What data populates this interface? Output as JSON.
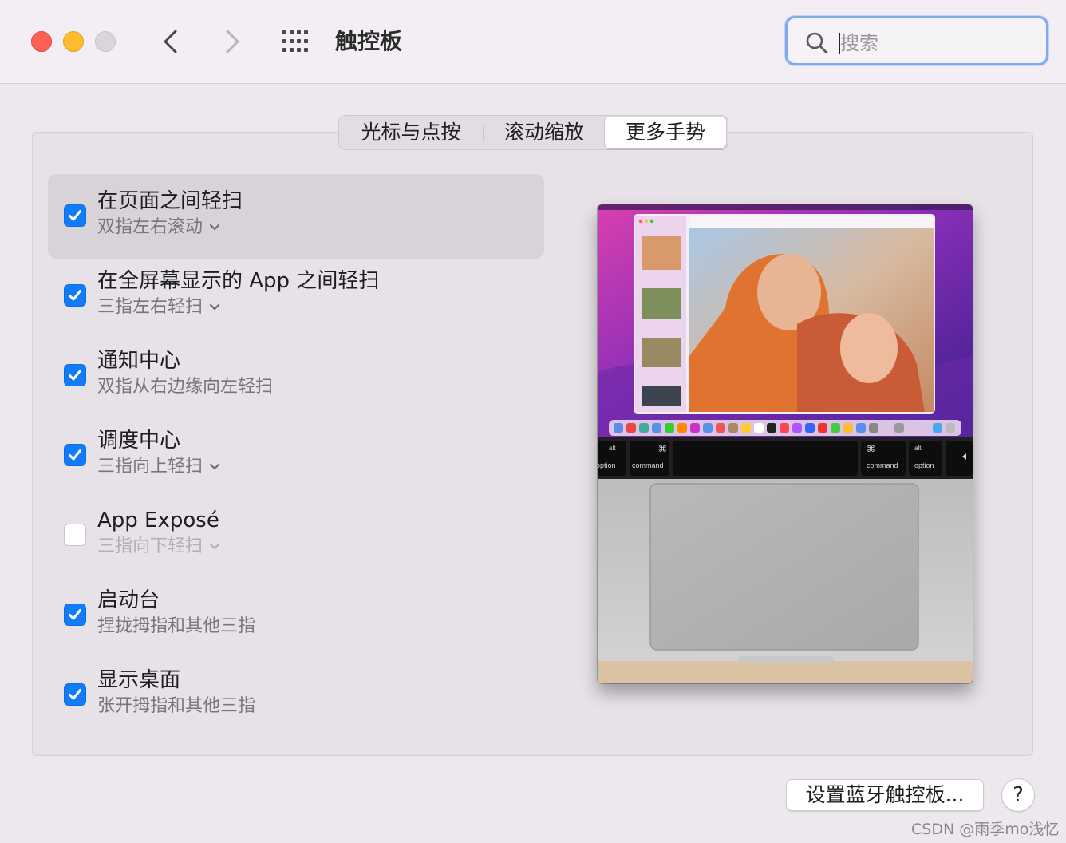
{
  "window": {
    "title": "触控板",
    "search_placeholder": "搜索"
  },
  "tabs": [
    {
      "label": "光标与点按",
      "selected": false
    },
    {
      "label": "滚动缩放",
      "selected": false
    },
    {
      "label": "更多手势",
      "selected": true
    }
  ],
  "gestures": [
    {
      "title": "在页面之间轻扫",
      "subtitle": "双指左右滚动",
      "checked": true,
      "has_dropdown": true,
      "selected": true
    },
    {
      "title": "在全屏幕显示的 App 之间轻扫",
      "subtitle": "三指左右轻扫",
      "checked": true,
      "has_dropdown": true,
      "selected": false
    },
    {
      "title": "通知中心",
      "subtitle": "双指从右边缘向左轻扫",
      "checked": true,
      "has_dropdown": false,
      "selected": false
    },
    {
      "title": "调度中心",
      "subtitle": "三指向上轻扫",
      "checked": true,
      "has_dropdown": true,
      "selected": false
    },
    {
      "title": "App Exposé",
      "subtitle": "三指向下轻扫",
      "checked": false,
      "has_dropdown": true,
      "selected": false
    },
    {
      "title": "启动台",
      "subtitle": "捏拢拇指和其他三指",
      "checked": true,
      "has_dropdown": false,
      "selected": false
    },
    {
      "title": "显示桌面",
      "subtitle": "张开拇指和其他三指",
      "checked": true,
      "has_dropdown": false,
      "selected": false
    }
  ],
  "preview": {
    "keys": {
      "left_alt": "alt",
      "left_option": "option",
      "left_command": "command",
      "right_command": "command",
      "right_alt": "alt",
      "right_option": "option"
    }
  },
  "footer": {
    "bluetooth_button": "设置蓝牙触控板...",
    "help_button": "?",
    "watermark": "CSDN @雨季mo浅忆"
  },
  "colors": {
    "accent": "#127bf7",
    "focus_ring": "#7fa9f3",
    "close": "#fe5f57",
    "minimize": "#febc2e"
  },
  "icons": [
    "close-icon",
    "minimize-icon",
    "zoom-icon",
    "chevron-left-icon",
    "chevron-right-icon",
    "grid-icon",
    "search-icon",
    "checkmark-icon",
    "chevron-down-icon",
    "command-icon"
  ]
}
